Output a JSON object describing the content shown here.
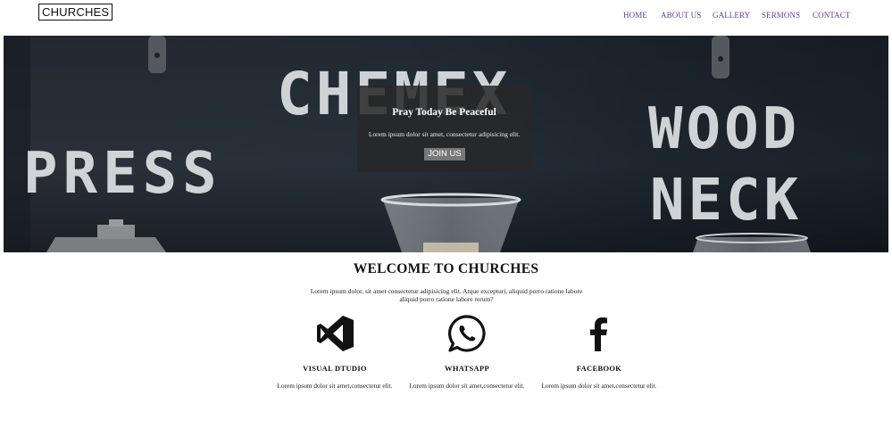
{
  "header": {
    "logo": "CHURCHES",
    "nav": [
      "HOME",
      "ABOUT US",
      "GALLERY",
      "SERMONS",
      "CONTACT"
    ]
  },
  "hero": {
    "wall_text": [
      "CHEMEX",
      "PRESS",
      "WOOD",
      "NECK"
    ],
    "title": "Pray Today Be Peaceful",
    "text": "Lorem ipsum dolor sit amet, consectetur adipisicing elit.",
    "button": "JOIN US"
  },
  "welcome": {
    "title": "WELCOME TO CHURCHES",
    "text": "Lorem ipsum dolor, sit amet consectetur adipisicing elit. Atque excepturi, aliquid porro ratione labore aliquid porro ratione labore rerum?"
  },
  "features": [
    {
      "icon": "visual-studio-icon",
      "title": "VISUAL DTUDIO",
      "text": "Lorem ipsum dolor sit amet,consectetur elit."
    },
    {
      "icon": "whatsapp-icon",
      "title": "WHATSAPP",
      "text": "Lorem ipsum dolor sit amet,consectetur elit."
    },
    {
      "icon": "facebook-icon",
      "title": "FACEBOOK",
      "text": "Lorem ipsum dolor sit amet,consectetur elit."
    }
  ],
  "colors": {
    "nav_link": "#6b3b96",
    "hero_overlay": "#282828",
    "button": "#777777"
  }
}
